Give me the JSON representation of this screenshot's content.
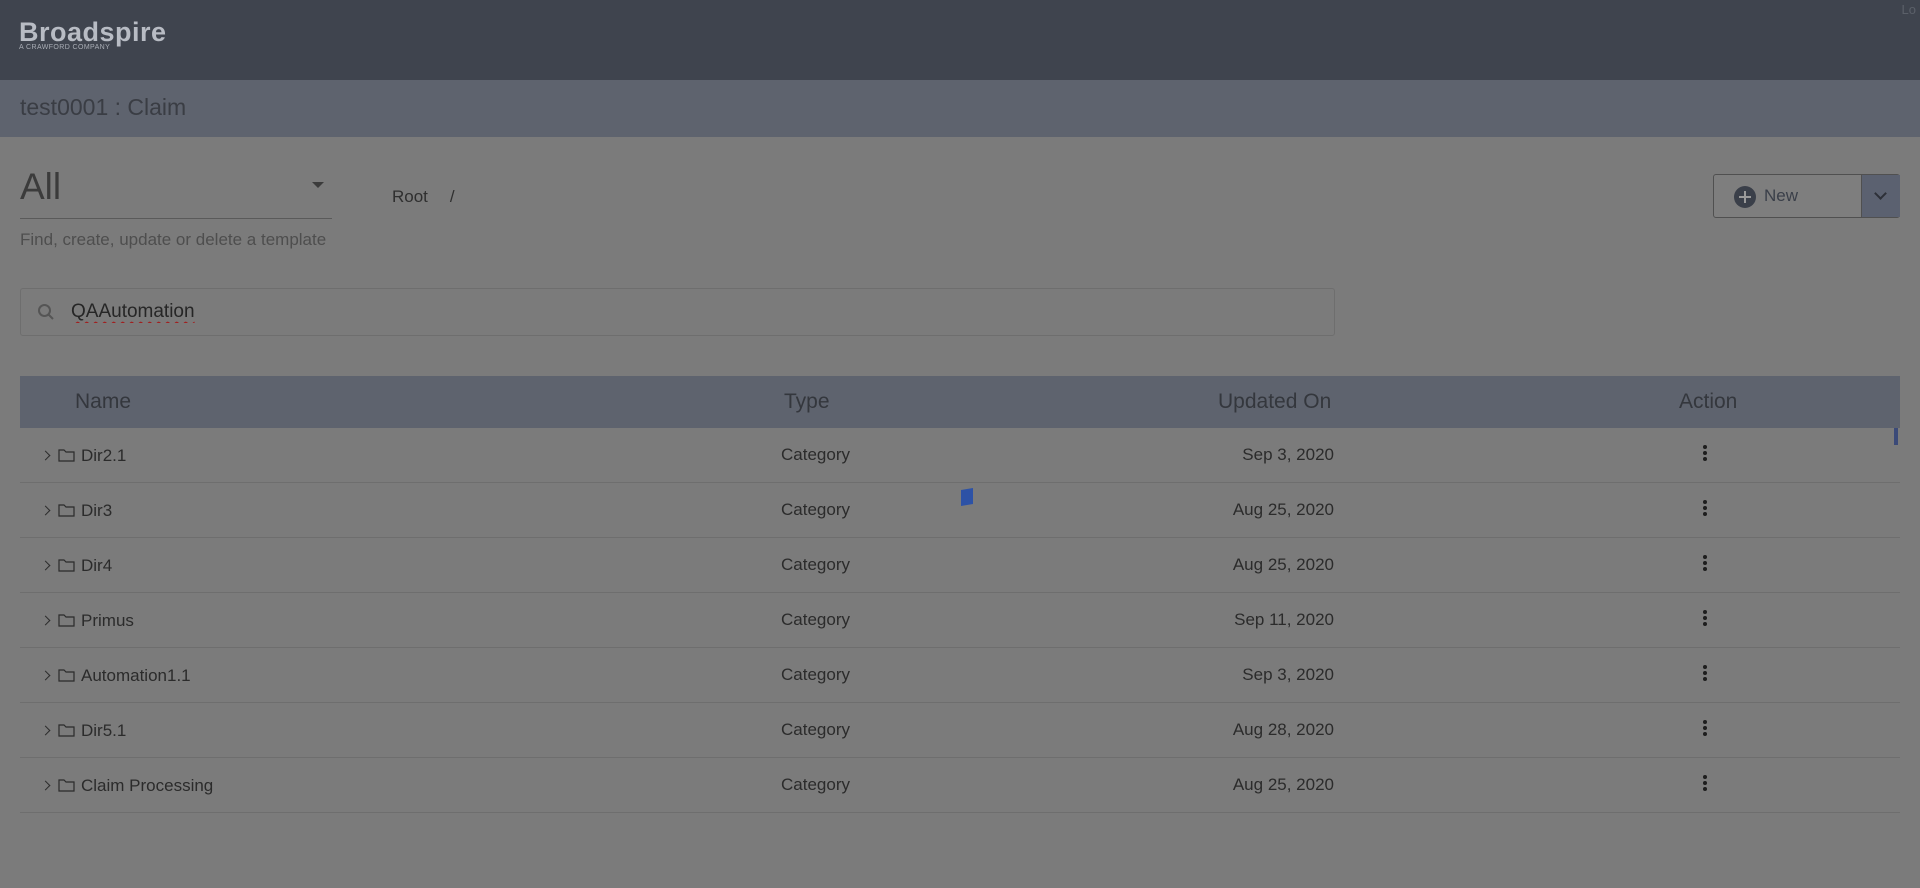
{
  "brand": {
    "name": "Broadspire",
    "tagline": "A CRAWFORD COMPANY",
    "corner_text": "Lo"
  },
  "header": {
    "title": "test0001 :  Claim"
  },
  "filter": {
    "selected": "All",
    "helper": "Find, create, update or delete a template"
  },
  "breadcrumb": {
    "root": "Root",
    "separator": "/"
  },
  "toolbar": {
    "new_label": "New"
  },
  "search": {
    "value": "QAAutomation"
  },
  "table": {
    "columns": [
      "Name",
      "Type",
      "Updated On",
      "Action"
    ],
    "rows": [
      {
        "name": "Dir2.1",
        "type": "Category",
        "updated": "Sep 3, 2020"
      },
      {
        "name": "Dir3",
        "type": "Category",
        "updated": "Aug 25, 2020"
      },
      {
        "name": "Dir4",
        "type": "Category",
        "updated": "Aug 25, 2020"
      },
      {
        "name": "Primus",
        "type": "Category",
        "updated": "Sep 11, 2020"
      },
      {
        "name": "Automation1.1",
        "type": "Category",
        "updated": "Sep 3, 2020"
      },
      {
        "name": "Dir5.1",
        "type": "Category",
        "updated": "Aug 28, 2020"
      },
      {
        "name": "Claim Processing",
        "type": "Category",
        "updated": "Aug 25, 2020"
      }
    ]
  },
  "colors": {
    "topbar": "#3f444e",
    "subheader": "#5e636e",
    "overlay_bg": "#7b7b7b",
    "spinner": "#2d52a6"
  }
}
